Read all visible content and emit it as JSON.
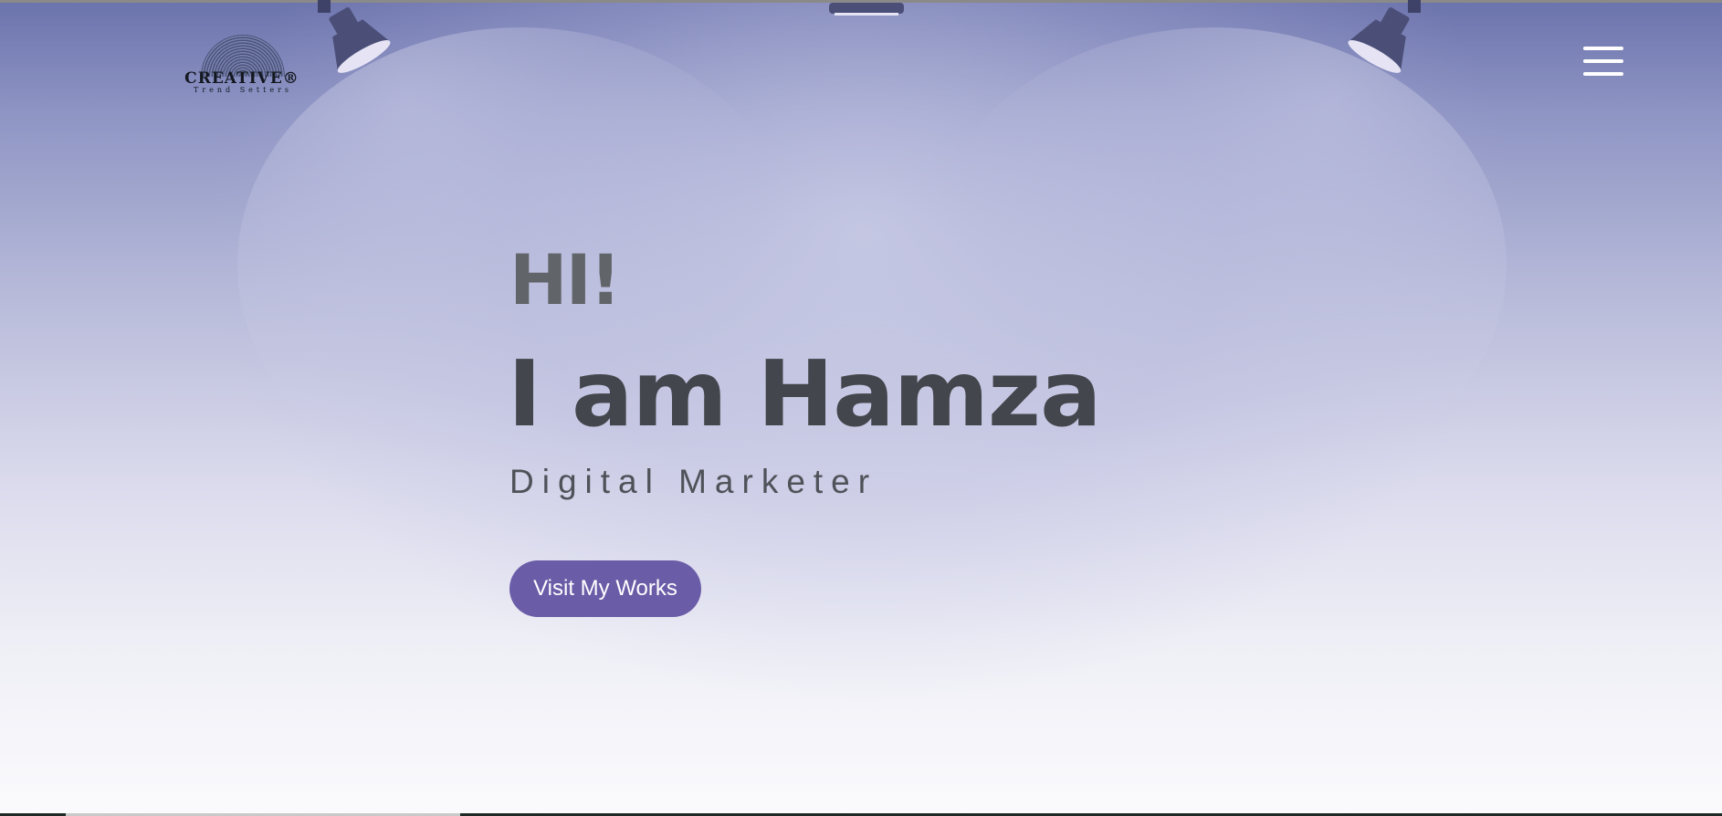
{
  "brand": {
    "logo_word": "CREATIVE®",
    "logo_tagline": "Trend Setters"
  },
  "nav": {
    "menu_icon": "hamburger-menu-icon"
  },
  "hero": {
    "greeting": "HI!",
    "name": "I am Hamza",
    "role": "Digital Marketer",
    "cta_label": "Visit My Works"
  },
  "colors": {
    "accent": "#6a5ca7",
    "heading": "#43464c",
    "greeting": "#616468",
    "background_top": "#6b73ac",
    "background_bottom": "#fbfbfd",
    "lamp": "#4b4f78"
  }
}
